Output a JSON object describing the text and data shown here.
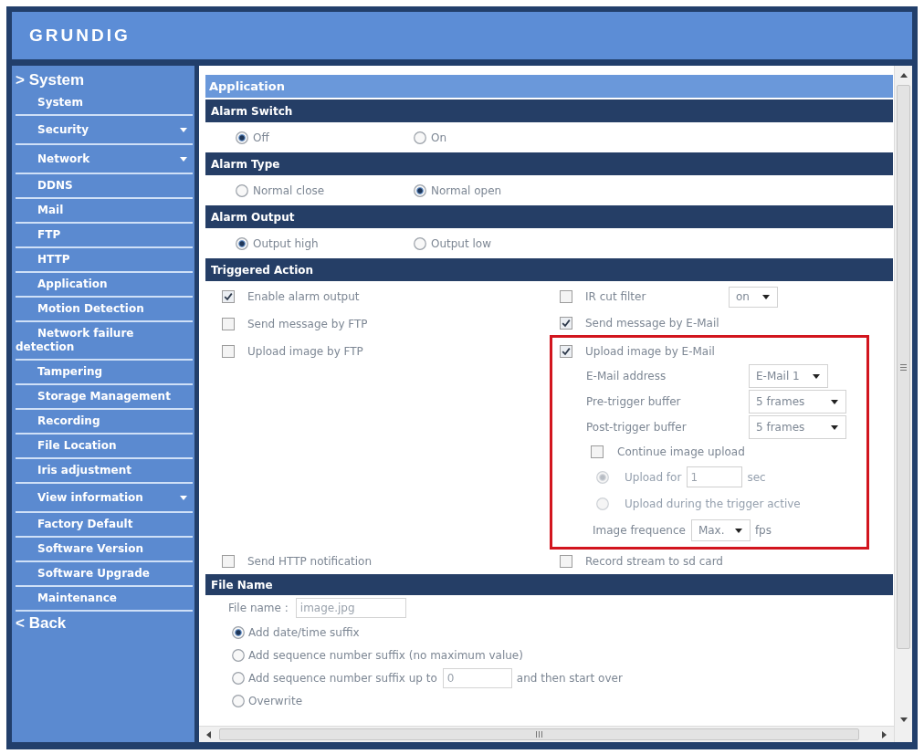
{
  "header": {
    "logo": "GRUNDIG"
  },
  "sidebar": {
    "title": "> System",
    "items": [
      {
        "label": "System",
        "has_submenu": false
      },
      {
        "label": "Security",
        "has_submenu": true
      },
      {
        "label": "Network",
        "has_submenu": true
      },
      {
        "label": "DDNS",
        "has_submenu": false
      },
      {
        "label": "Mail",
        "has_submenu": false
      },
      {
        "label": "FTP",
        "has_submenu": false
      },
      {
        "label": "HTTP",
        "has_submenu": false
      },
      {
        "label": "Application",
        "has_submenu": false
      },
      {
        "label": "Motion Detection",
        "has_submenu": false
      },
      {
        "label": "Network failure detection",
        "has_submenu": false
      },
      {
        "label": "Tampering",
        "has_submenu": false
      },
      {
        "label": "Storage Management",
        "has_submenu": false
      },
      {
        "label": "Recording",
        "has_submenu": false
      },
      {
        "label": "File Location",
        "has_submenu": false
      },
      {
        "label": "Iris adjustment",
        "has_submenu": false
      },
      {
        "label": "View information",
        "has_submenu": true
      },
      {
        "label": "Factory Default",
        "has_submenu": false
      },
      {
        "label": "Software Version",
        "has_submenu": false
      },
      {
        "label": "Software Upgrade",
        "has_submenu": false
      },
      {
        "label": "Maintenance",
        "has_submenu": false
      }
    ],
    "back": "< Back"
  },
  "page_title": "Application",
  "alarm_switch": {
    "title": "Alarm Switch",
    "options": [
      {
        "label": "Off",
        "selected": true
      },
      {
        "label": "On",
        "selected": false
      }
    ]
  },
  "alarm_type": {
    "title": "Alarm Type",
    "options": [
      {
        "label": "Normal close",
        "selected": false
      },
      {
        "label": "Normal open",
        "selected": true
      }
    ]
  },
  "alarm_output": {
    "title": "Alarm Output",
    "options": [
      {
        "label": "Output high",
        "selected": true
      },
      {
        "label": "Output low",
        "selected": false
      }
    ]
  },
  "triggered_action": {
    "title": "Triggered Action",
    "left_items": [
      {
        "label": "Enable alarm output",
        "checked": true
      },
      {
        "label": "Send message by FTP",
        "checked": false
      },
      {
        "label": "Upload image by FTP",
        "checked": false
      }
    ],
    "ir_cut_filter": {
      "label": "IR cut filter",
      "checked": false,
      "value": "on"
    },
    "email_message": {
      "label": "Send message by E-Mail",
      "checked": true
    },
    "email_upload": {
      "label": "Upload image by E-Mail",
      "checked": true,
      "highlighted": true,
      "settings": [
        {
          "label": "E-Mail address",
          "value": "E-Mail 1"
        },
        {
          "label": "Pre-trigger buffer",
          "value": "5 frames"
        },
        {
          "label": "Post-trigger buffer",
          "value": "5 frames"
        }
      ],
      "continue_upload": {
        "label": "Continue image upload",
        "checked": false
      },
      "upload_modes": [
        {
          "kind": "duration",
          "label": "Upload for",
          "value": "1",
          "unit": "sec",
          "selected": true,
          "disabled": true
        },
        {
          "kind": "plain",
          "label": "Upload during the trigger active",
          "selected": false,
          "disabled": true
        }
      ],
      "image_frequence": {
        "label": "Image frequence",
        "value": "Max.",
        "unit": "fps"
      }
    },
    "http_notification": {
      "label": "Send HTTP notification",
      "checked": false
    },
    "record_stream": {
      "label": "Record stream to sd card",
      "checked": false
    }
  },
  "file_name": {
    "title": "File Name",
    "label": "File name :",
    "value": "image.jpg",
    "options": [
      {
        "kind": "plain",
        "label": "Add date/time suffix",
        "selected": true
      },
      {
        "kind": "plain",
        "label": "Add sequence number suffix (no maximum value)",
        "selected": false
      },
      {
        "kind": "limit",
        "label": "Add sequence number suffix up to",
        "value": "0",
        "after": "and then start over",
        "selected": false
      },
      {
        "kind": "plain",
        "label": "Overwrite",
        "selected": false
      }
    ]
  }
}
